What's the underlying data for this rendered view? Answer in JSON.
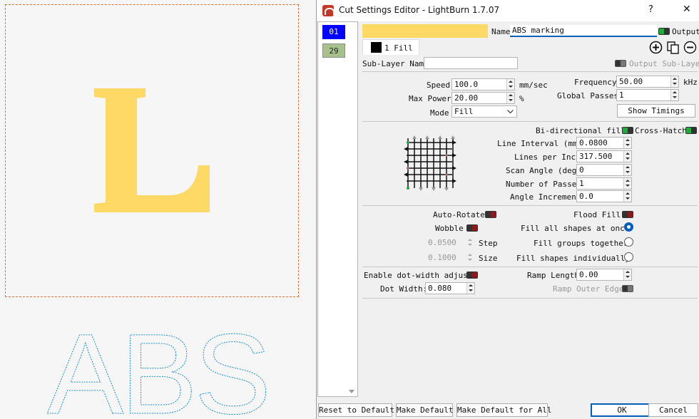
{
  "window": {
    "title": "Cut Settings Editor - LightBurn 1.7.07",
    "help_label": "?",
    "close_label": "✕"
  },
  "canvas": {
    "letter": "L",
    "letter_color": "#ffd966",
    "outline_text": "ABS",
    "outline_color": "#1a8fc9",
    "workarea_border_color": "#e0703a"
  },
  "layers": [
    {
      "id": "01",
      "color": "#0000ff"
    },
    {
      "id": "29",
      "color": "#a7c08c"
    }
  ],
  "header": {
    "layer_color": "#ffd966",
    "name_label": "Name",
    "name_value": "ABS marking",
    "output_label": "Output",
    "tab_label": "1 Fill",
    "tab_swatch_color": "#000000",
    "sublayer_name_label": "Sub-Layer Name",
    "sublayer_name_value": "",
    "output_sublayer_label": "Output Sub-Layer"
  },
  "power": {
    "speed_label": "Speed",
    "speed_value": "100.0",
    "speed_unit": "mm/sec",
    "max_power_label": "Max Power",
    "max_power_value": "20.00",
    "max_power_unit": "%",
    "mode_label": "Mode",
    "mode_value": "Fill",
    "frequency_label": "Frequency",
    "frequency_value": "50.00",
    "frequency_unit": "kHz",
    "global_passes_label": "Global Passes",
    "global_passes_value": "1",
    "show_timings_label": "Show Timings"
  },
  "fill": {
    "bidirectional_label": "Bi-directional fill",
    "crosshatch_label": "Cross-Hatch",
    "line_interval_label": "Line Interval (mm)",
    "line_interval_value": "0.0800",
    "lines_per_inch_label": "Lines per Inch",
    "lines_per_inch_value": "317.500",
    "scan_angle_label": "Scan Angle (deg)",
    "scan_angle_value": "0",
    "num_passes_label": "Number of Passes",
    "num_passes_value": "1",
    "angle_increment_label": "Angle Increment",
    "angle_increment_value": "0.0"
  },
  "options": {
    "auto_rotate_label": "Auto-Rotate",
    "flood_fill_label": "Flood Fill",
    "wobble_label": "Wobble",
    "fill_all_label": "Fill all shapes at once",
    "step_value": "0.0500",
    "step_label": "Step",
    "fill_groups_label": "Fill groups together",
    "size_value": "0.1000",
    "size_label": "Size",
    "fill_individually_label": "Fill shapes individually"
  },
  "dot": {
    "enable_dot_label": "Enable dot-width adjust",
    "dot_width_label": "Dot Width:",
    "dot_width_value": "0.080",
    "ramp_length_label": "Ramp Length",
    "ramp_length_value": "0.00",
    "ramp_outer_label": "Ramp Outer Edge"
  },
  "footer": {
    "reset_label": "Reset to Default",
    "make_default_label": "Make Default",
    "make_default_all_label": "Make Default for All",
    "ok_label": "OK",
    "cancel_label": "Cancel"
  }
}
